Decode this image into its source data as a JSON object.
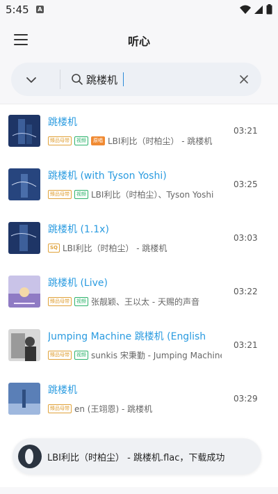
{
  "status_bar": {
    "time": "5:45",
    "notification_glyph": "A"
  },
  "app_bar": {
    "title": "听心"
  },
  "search": {
    "value": "跳楼机"
  },
  "songs": [
    {
      "title": "跳楼机",
      "badges": [
        "臻品母带",
        "视频",
        "原唱"
      ],
      "meta": "LBI利比（时柏尘） - 跳楼机",
      "duration": "03:21"
    },
    {
      "title": "跳楼机 (with Tyson Yoshi)",
      "badges": [
        "臻品母带",
        "视频"
      ],
      "meta": "LBI利比（时柏尘）、Tyson Yoshi",
      "duration": "03:25"
    },
    {
      "title": "跳楼机 (1.1x)",
      "badges": [
        "SQ"
      ],
      "meta": "LBI利比（时柏尘） - 跳楼机",
      "duration": "03:03"
    },
    {
      "title": "跳楼机 (Live)",
      "badges": [
        "臻品母带",
        "视频"
      ],
      "meta": "张靓颖、王以太 - 天赐的声音",
      "duration": "03:22"
    },
    {
      "title": "Jumping Machine 跳楼机 (English",
      "badges": [
        "臻品母带",
        "视频"
      ],
      "meta": "sunkis 宋秉勤 - Jumping Machine",
      "duration": "03:21"
    },
    {
      "title": "跳楼机",
      "badges": [
        "臻品母带"
      ],
      "meta": "en (王翊恩) - 跳楼机",
      "duration": "03:29"
    }
  ],
  "toast": {
    "message": "LBI利比（时柏尘） - 跳楼机.flac，下载成功"
  },
  "colors": {
    "accent": "#2a9be0",
    "badge_gold": "#e0a23a",
    "badge_green": "#2bb26a",
    "badge_orange": "#f08a32"
  }
}
